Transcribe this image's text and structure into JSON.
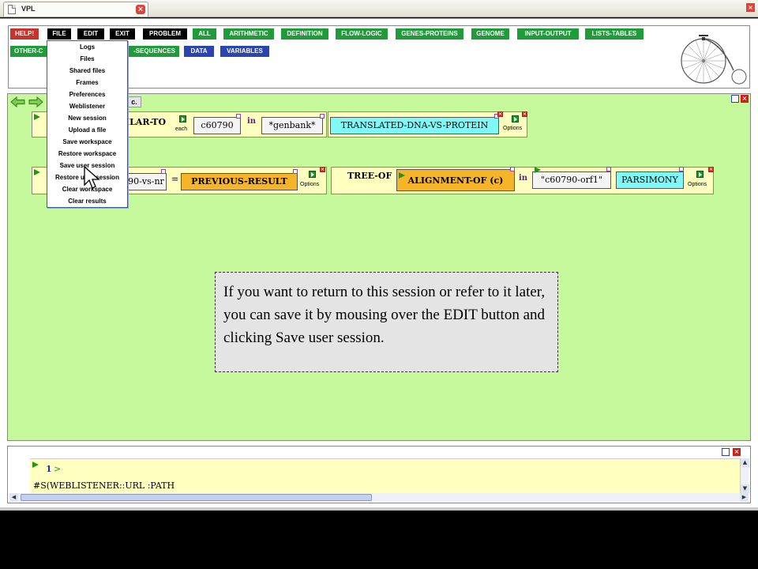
{
  "browser": {
    "tab_title": "VPL",
    "tab_close": "×",
    "window_close": "×"
  },
  "toolbar": {
    "row1": [
      {
        "label": "HELP!",
        "color": "red"
      },
      {
        "label": "FILE",
        "color": "black"
      },
      {
        "label": "EDIT",
        "color": "black"
      },
      {
        "label": "EXIT",
        "color": "black"
      },
      {
        "label": "PROBLEM",
        "color": "black"
      },
      {
        "label": "ALL",
        "color": "green"
      },
      {
        "label": "ARITHMETIC",
        "color": "green"
      },
      {
        "label": "DEFINITION",
        "color": "green"
      },
      {
        "label": "FLOW-LOGIC",
        "color": "green"
      },
      {
        "label": "GENES-PROTEINS",
        "color": "green"
      },
      {
        "label": "GENOME",
        "color": "green"
      },
      {
        "label": "INPUT-OUTPUT",
        "color": "green"
      },
      {
        "label": "LISTS-TABLES",
        "color": "green"
      }
    ],
    "row2": [
      {
        "label": "OTHER-C",
        "color": "green"
      },
      {
        "label": "-SEQUENCES",
        "color": "green"
      },
      {
        "label": "DATA",
        "color": "blue"
      },
      {
        "label": "VARIABLES",
        "color": "blue"
      }
    ]
  },
  "workspace": {
    "results_tab": "c.",
    "row1": {
      "keyword": "ILAR-TO",
      "each_label": "each",
      "arg1": "c60790",
      "in_word": "in",
      "arg2": "*genbank*",
      "arg3": "TRANSLATED-DNA-VS-PROTEIN",
      "options_label": "Options"
    },
    "row2": {
      "arg1": "90-vs-nr",
      "equals": "=",
      "arg2": "PREVIOUS-RESULT",
      "options_label": "Options"
    },
    "row3": {
      "keyword": "TREE-OF",
      "inner_keyword": "ALIGNMENT-OF (c)",
      "in_word": "in",
      "arg1": "\"c60790-orf1\"",
      "arg2": "PARSIMONY",
      "options_label": "Options"
    }
  },
  "tooltip": {
    "text": "If you want to return to this session or refer to it later, you can save it by mousing over the EDIT button and clicking Save user session."
  },
  "edit_menu": {
    "items": [
      "Logs",
      "Files",
      "Shared files",
      "Frames",
      "Preferences",
      "Weblistener",
      "New session",
      "Upload a file",
      "Save workspace",
      "Restore workspace",
      "Save user session",
      "Restore user session",
      "Clear workspace",
      "Clear results"
    ],
    "hovered": "Save user session"
  },
  "listener": {
    "prompt_number": "1",
    "prompt_gt": ">",
    "text": "#S(WEBLISTENER::URL :PATH"
  },
  "colors": {
    "workspace_bg": "#c6f99c",
    "button_green": "#1f9b3a",
    "button_black": "#000000",
    "button_red": "#c8322c",
    "button_blue": "#2a44b0",
    "menu_border": "#3b57b8"
  }
}
